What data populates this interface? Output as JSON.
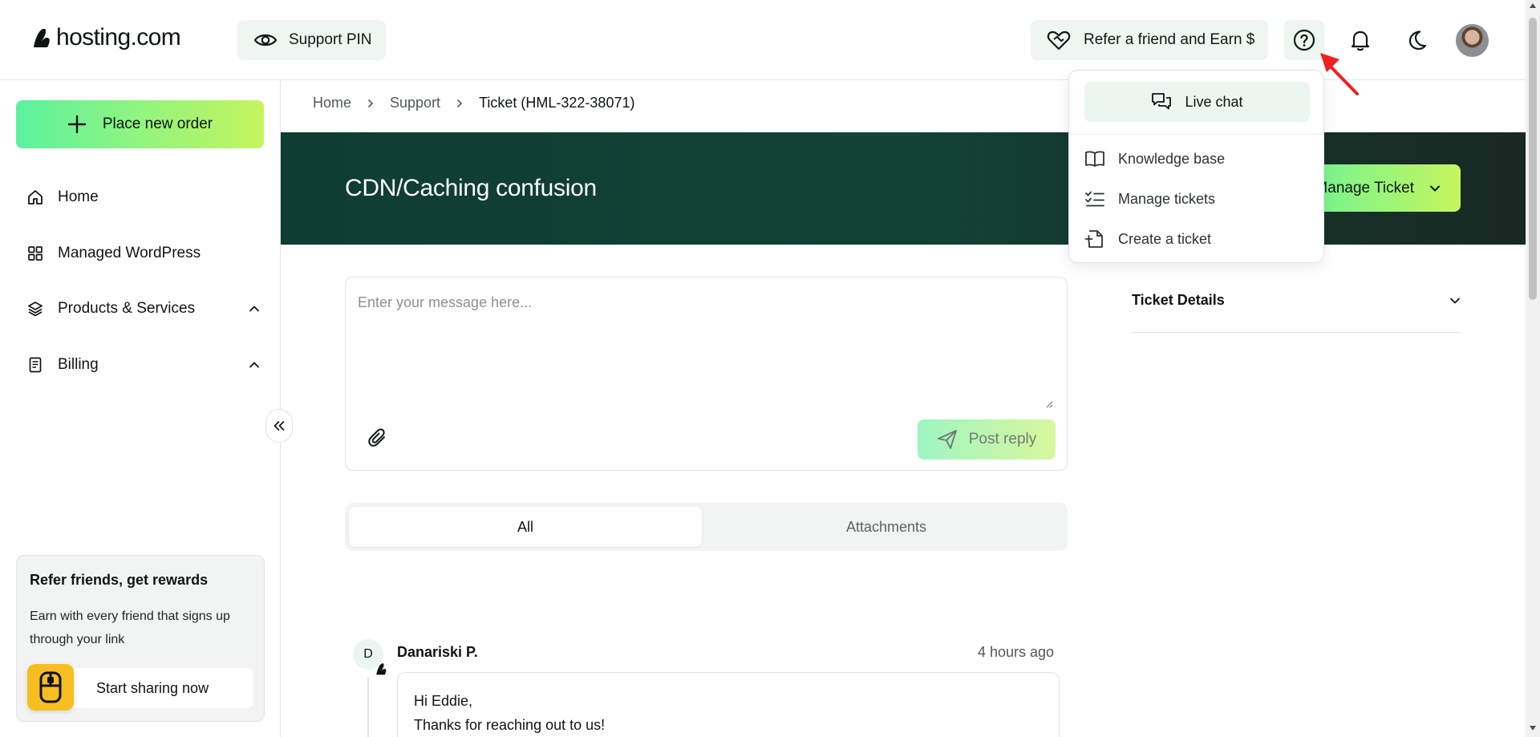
{
  "header": {
    "logo_text": "hosting.com",
    "support_pin_label": "Support PIN",
    "refer_label": "Refer a friend and Earn $"
  },
  "sidebar": {
    "place_order_label": "Place new order",
    "items": [
      {
        "label": "Home",
        "icon": "home-icon"
      },
      {
        "label": "Managed WordPress",
        "icon": "grid-icon"
      },
      {
        "label": "Products & Services",
        "icon": "layers-icon"
      },
      {
        "label": "Billing",
        "icon": "receipt-icon"
      }
    ],
    "refer_card": {
      "title": "Refer friends, get rewards",
      "body": "Earn with every friend that signs up through your link",
      "button_label": "Start sharing now"
    }
  },
  "breadcrumb": {
    "items": [
      "Home",
      "Support",
      "Ticket (HML-322-38071)"
    ]
  },
  "ticket": {
    "title": "CDN/Caching confusion",
    "manage_label": "Manage Ticket",
    "details_label": "Ticket Details"
  },
  "composer": {
    "placeholder": "Enter your message here...",
    "value": "",
    "post_label": "Post reply"
  },
  "tabs": [
    {
      "label": "All",
      "active": true
    },
    {
      "label": "Attachments",
      "active": false
    }
  ],
  "message": {
    "avatar_initial": "D",
    "author": "Danariski P.",
    "time": "4 hours ago",
    "lines": [
      "Hi Eddie,",
      "Thanks for reaching out to us!"
    ]
  },
  "help_menu": {
    "live_chat_label": "Live chat",
    "items": [
      {
        "label": "Knowledge base",
        "icon": "book-icon"
      },
      {
        "label": "Manage tickets",
        "icon": "checklist-icon"
      },
      {
        "label": "Create a ticket",
        "icon": "file-plus-icon"
      }
    ]
  },
  "colors": {
    "accent_gradient_start": "#5cf2a0",
    "accent_gradient_end": "#c5f55e",
    "banner": "#0f3c33",
    "soft_green": "#eff5f1",
    "badge_yellow": "#f7be22",
    "pointer_red": "#f02020"
  }
}
